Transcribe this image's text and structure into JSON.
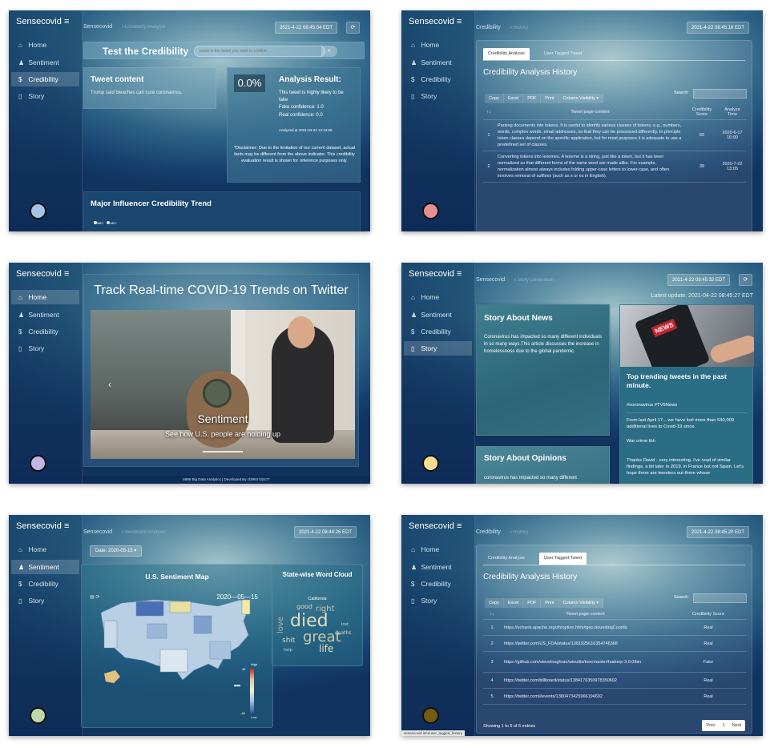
{
  "brand": "Sensecovid",
  "menu_icon": "≡",
  "nav": [
    "Home",
    "Sentiment",
    "Credibility",
    "Story"
  ],
  "p1": {
    "crumb": "Sensecovid",
    "crumb_sub": "Credibility Analysis",
    "time": "2021-4-22 08:45:04 EDT",
    "test_title": "Test the Credibility",
    "search_placeholder": "paste in the tweet you want to confirm",
    "tweet_title": "Tweet content",
    "tweet_text": "Trump said bleaches can cure coronavirus.",
    "score": "0.0%",
    "result_title": "Analysis Result:",
    "result_line1": "This tweet is highly likely to be fake",
    "result_line2": "Fake confidence: 1.0",
    "result_line3": "Real confidence: 0.0",
    "analyzed": "Analyzed at 2021-04-22 12:44:59",
    "disclaimer": "*Disclaimer: Due to the limitation of our current dataset, actual facts may be different from the above indicator. This credibility evaluation result is shown for reference purposes only.",
    "trend_title": "Major Influencer Credibility Trend",
    "legend": [
      "BBC",
      "ABC"
    ],
    "dot_color": "#a6c3e6"
  },
  "p2": {
    "crumb": "Credibility",
    "crumb_sub": "History",
    "time": "2021-4-22 08:45:16 EDT",
    "tabs": [
      "Credibility Analysis",
      "User Tagged Tweet"
    ],
    "heading": "Credibility Analysis History",
    "buttons": [
      "Copy",
      "Excel",
      "PDF",
      "Print",
      "Column Visibility ▾"
    ],
    "search_label": "Search:",
    "columns": [
      "↑↓",
      "Tweet page-content",
      "Credibility Score",
      "Analyze Time"
    ],
    "rows": [
      {
        "n": "1",
        "text": "Parsing documents into tokens. It is useful to identify various classes of tokens, e.g., numbers, words, complex words, email addresses, so that they can be processed differently. In principle token classes depend on the specific application, but for most purposes it is adequate to use a predefined set of classes.",
        "score": "60",
        "time": "2020-6-17 10:00"
      },
      {
        "n": "2",
        "text": "Converting tokens into lexemes. A lexeme is a string, just like a token, but it has been normalized so that different forms of the same word are made alike. For example, normalization almost always includes folding upper-case letters to lower-case, and often involves removal of suffixes (such as s or es in English).",
        "score": "39",
        "time": "2020-7-22 13:05"
      }
    ],
    "dot_color": "#e58f90"
  },
  "p3": {
    "banner": "Track Real-time COVID-19 Trends on Twitter",
    "slide_title": "Sentiment",
    "slide_sub": "See how U.S. people are holding up",
    "footer": "6895 Big Data Analytics | Developed By cl2993 bl2477",
    "dot_color": "#c2b5e3"
  },
  "p4": {
    "crumb": "Sensecovid",
    "crumb_sub": "Story Generation",
    "time": "2021-4-22 08:45:32 EDT",
    "update": "Latest update: 2021-04-22 08:45:27 EDT",
    "news_title": "Story About News",
    "news_text": "Coronavirus has impacted so many different individuals in so many ways.This article discusses the increase in homelessness due to the global pandemic.",
    "trend_title": "Top trending tweets in the past minute.",
    "tweets": [
      "#coronavirus #TV9News",
      "From last April 17... we have lost more than 530,000 additional lives to Covid-19 since.",
      "War crime tbh",
      "Thanks David - very interesting. I've read of similar findings, a bit later in 2019, in France but not Spain. Let's hope there are tweeters out there whose"
    ],
    "op_title": "Story About Opinions",
    "op_text": "coronavirus has impacted so many different",
    "news_badge": "NEWS",
    "dot_color": "#f7dc93"
  },
  "p5": {
    "crumb": "Sensecovid",
    "crumb_sub": "Sentiment Analysis",
    "time": "2021-4-22 08:44:26 EDT",
    "date_btn": "Date: 2020-05-15 ▾",
    "map_title": "U.S. Sentiment Map",
    "map_date": "2020—05—15",
    "scale_high": "High",
    "scale_low": "Low",
    "scale_top": "45",
    "scale_bottom": "-45",
    "cloud_title": "State-wise Word Cloud",
    "cloud_state": "California",
    "words": [
      "died",
      "great",
      "life",
      "good",
      "right",
      "love",
      "shit",
      "deaths",
      "lost",
      "help"
    ],
    "dot_color": "#bfd8a8"
  },
  "p6": {
    "crumb": "Credibility",
    "crumb_sub": "History",
    "time": "2021-4-22 08:45:20 EDT",
    "tabs": [
      "Credibility Analysis",
      "User Tagged Tweet"
    ],
    "heading": "Credibility Analysis History",
    "buttons": [
      "Copy",
      "Excel",
      "PDF",
      "Print",
      "Column Visibility ▾"
    ],
    "search_label": "Search:",
    "columns": [
      "↑↓",
      "Tweet page-content",
      "Credibility Score"
    ],
    "rows": [
      {
        "n": "1",
        "url": "https://echarts.apache.org/zh/option.html#geo.boundingCoords",
        "score": "Real"
      },
      {
        "n": "2",
        "url": "https://twitter.com/US_FDA/status/1381925616354746368",
        "score": "Real"
      },
      {
        "n": "3",
        "url": "https://github.com/steveloughran/winutils/tree/master/hadoop-3.0.0/bin",
        "score": "Fake"
      },
      {
        "n": "4",
        "url": "https://twitter.com/billboard/status/1384176350978350602",
        "score": "Real"
      },
      {
        "n": "5",
        "url": "https://twitter.com/i/events/1380473425966194692",
        "score": "Real"
      }
    ],
    "showing": "Showing 1 to 5 of 5 entries",
    "prev": "Prev",
    "page": "1",
    "next": "Next",
    "status_url": "sensecovid.info/user_tagged_history",
    "dot_color": "#735b14"
  }
}
